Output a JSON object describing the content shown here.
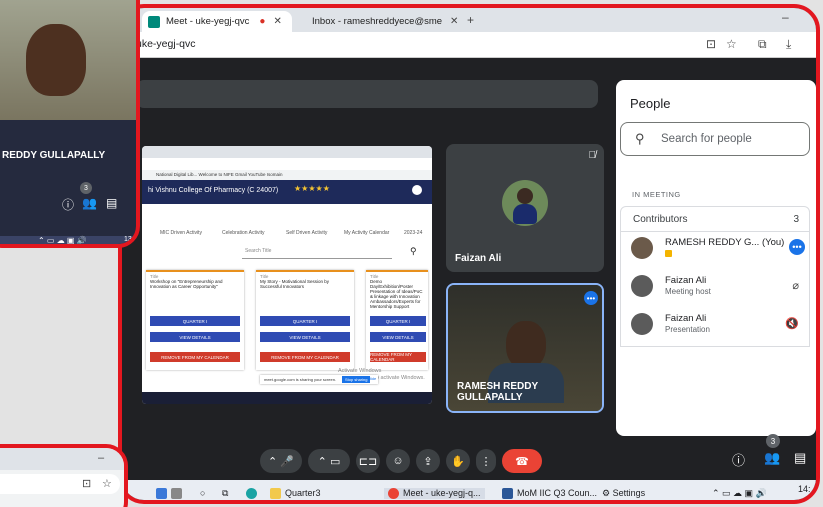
{
  "browser": {
    "tabs": [
      {
        "label": "Meet - uke-yegj-qvc",
        "active": true,
        "favicon_color": "#00897b"
      },
      {
        "label": "Inbox - rameshreddyece@sme",
        "active": false,
        "favicon_color": "#ea4335"
      }
    ],
    "url": "uke-yegj-qvc",
    "new_tab_symbol": "+"
  },
  "shared_screen": {
    "bookmarks": "National Digital Lib...   Welcome to NIFE   Gmail   YouTube   Isomain",
    "college_name": "hi Vishnu College Of Pharmacy (C 24007)",
    "menu": [
      "MIC Driven Activity",
      "Celebration Activity",
      "Self Driven Activity",
      "My Activity Calendar",
      "2023-24"
    ],
    "search_placeholder": "Search Title",
    "cards": [
      {
        "title_label": "Title",
        "title": "Workshop on \"Entrepreneurship and Innovation as Career Opportunity\""
      },
      {
        "title_label": "Title",
        "title": "My Story - Motivational Session by Successful Innovators"
      },
      {
        "title_label": "Title",
        "title": "Demo Day/Exhibition/Poster Presentation of Ideas/PoC & linkage with Innovation Ambassadors/Experts for Mentorship Support"
      }
    ],
    "card_buttons": [
      "QUARTER I",
      "VIEW DETAILS",
      "REMOVE FROM MY CALENDAR"
    ],
    "sharing_banner": "meet.google.com is sharing your screen.",
    "stop_sharing": "Stop sharing",
    "hide": "Hide",
    "activate_windows": "Activate Windows",
    "activate_hint": "Go to Settings to activate Windows."
  },
  "tiles": [
    {
      "name": "Faizan Ali"
    },
    {
      "name": "RAMESH REDDY GULLAPALLY"
    }
  ],
  "people_panel": {
    "heading": "People",
    "search_placeholder": "Search for people",
    "section": "IN MEETING",
    "group_label": "Contributors",
    "group_count": "3",
    "members": [
      {
        "name": "RAMESH REDDY G...  (You)",
        "sub": ""
      },
      {
        "name": "Faizan Ali",
        "sub": "Meeting host"
      },
      {
        "name": "Faizan Ali",
        "sub": "Presentation"
      }
    ]
  },
  "controls": {
    "participant_count": "3"
  },
  "taskbar": {
    "items": [
      "Quarter3",
      "Meet - uke-yegj-q...",
      "MoM IIC Q3 Coun...",
      "Settings"
    ],
    "clock": "14:"
  },
  "webcam_overlay": {
    "name": "REDDY GULLAPALLY",
    "count": "3",
    "clock": "13:"
  },
  "colors": {
    "frame_red": "#e3171f",
    "meet_bg": "#202124",
    "accent_blue": "#1a73e8",
    "end_call_red": "#ea4335"
  }
}
